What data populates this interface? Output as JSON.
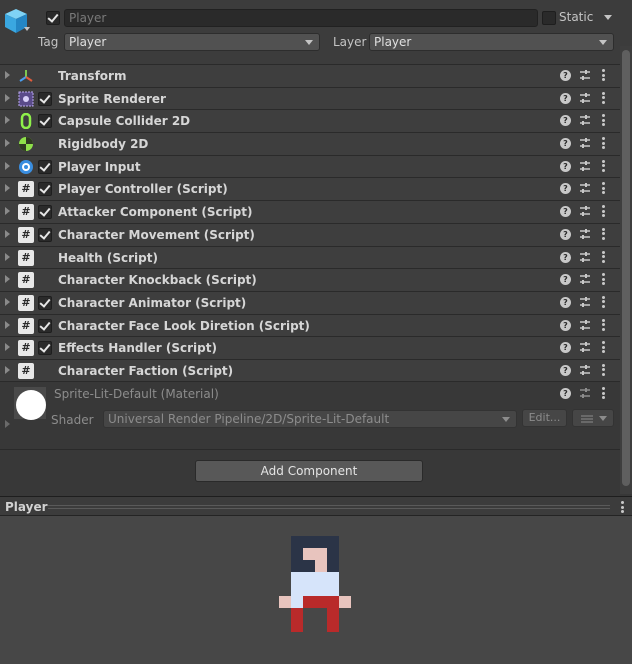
{
  "header": {
    "object_name": "Player",
    "active_checked": true,
    "static_label": "Static",
    "static_checked": false,
    "tag_label": "Tag",
    "tag_value": "Player",
    "layer_label": "Layer",
    "layer_value": "Player"
  },
  "components": [
    {
      "name": "Transform",
      "icon": "transform-icon",
      "has_toggle": false
    },
    {
      "name": "Sprite Renderer",
      "icon": "sprite-renderer-icon",
      "has_toggle": true,
      "enabled": true
    },
    {
      "name": "Capsule Collider 2D",
      "icon": "capsule-collider-icon",
      "has_toggle": true,
      "enabled": true
    },
    {
      "name": "Rigidbody 2D",
      "icon": "rigidbody-icon",
      "has_toggle": false
    },
    {
      "name": "Player Input",
      "icon": "player-input-icon",
      "has_toggle": true,
      "enabled": true
    },
    {
      "name": "Player Controller (Script)",
      "icon": "script-icon",
      "has_toggle": true,
      "enabled": true
    },
    {
      "name": "Attacker Component (Script)",
      "icon": "script-icon",
      "has_toggle": true,
      "enabled": true
    },
    {
      "name": "Character Movement (Script)",
      "icon": "script-icon",
      "has_toggle": true,
      "enabled": true
    },
    {
      "name": "Health (Script)",
      "icon": "script-icon",
      "has_toggle": false
    },
    {
      "name": "Character Knockback (Script)",
      "icon": "script-icon",
      "has_toggle": false
    },
    {
      "name": "Character Animator (Script)",
      "icon": "script-icon",
      "has_toggle": true,
      "enabled": true
    },
    {
      "name": "Character Face Look Diretion (Script)",
      "icon": "script-icon",
      "has_toggle": true,
      "enabled": true
    },
    {
      "name": "Effects Handler (Script)",
      "icon": "script-icon",
      "has_toggle": true,
      "enabled": true
    },
    {
      "name": "Character Faction (Script)",
      "icon": "script-icon",
      "has_toggle": false
    }
  ],
  "row_icons": {
    "help": "?"
  },
  "material": {
    "name": "Sprite-Lit-Default (Material)",
    "shader_label": "Shader",
    "shader_value": "Universal Render Pipeline/2D/Sprite-Lit-Default",
    "edit_label": "Edit..."
  },
  "add_component_label": "Add Component",
  "preview": {
    "title": "Player"
  },
  "colors": {
    "background": "#383838",
    "header": "#3c3c3c",
    "preview_bg": "#474747",
    "sprite_hair": "#2b3447",
    "sprite_skin": "#e8c4be",
    "sprite_shirt": "#d6e4fa",
    "sprite_pants": "#b92a2a"
  }
}
